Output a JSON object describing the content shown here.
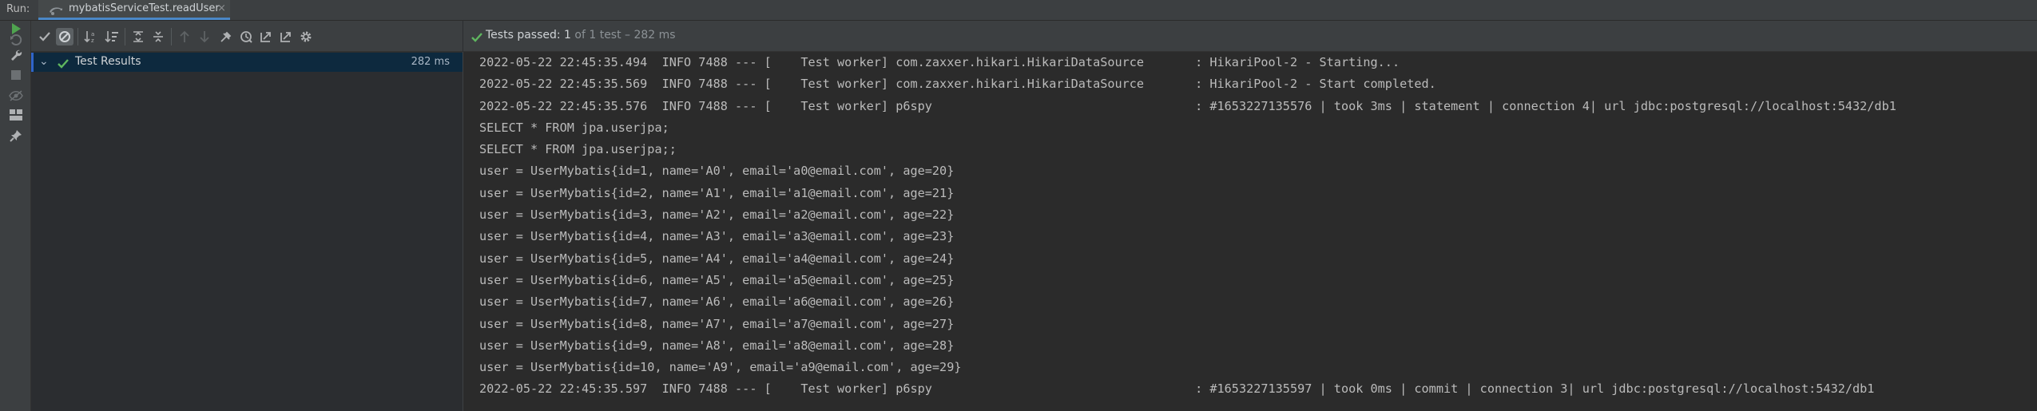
{
  "run_label": "Run:",
  "tab": {
    "title": "mybatisServiceTest.readUser",
    "close": "×",
    "icon": "test-config-icon"
  },
  "left_strip": {
    "icons": [
      "rerun-icon",
      "rerun-failed-icon",
      "wrench-icon",
      "stop-icon",
      "eye-icon",
      "layout-icon",
      "pin-icon"
    ]
  },
  "toolbar": {
    "icons": [
      "show-passed-icon",
      "show-ignored-icon",
      "sort-alpha-icon",
      "sort-duration-icon",
      "expand-all-icon",
      "collapse-all-icon",
      "previous-failed-icon",
      "next-failed-icon",
      "import-tests-icon",
      "history-icon",
      "export-icon",
      "open-external-icon",
      "settings-gear-icon"
    ],
    "pressed": "show-ignored-icon"
  },
  "status": {
    "text": "Tests passed: 1",
    "detail": " of 1 test – 282 ms",
    "color": "#5fb65f"
  },
  "tree": {
    "root": {
      "label": "Test Results",
      "time": "282 ms",
      "expanded": true,
      "status": "passed"
    }
  },
  "console": {
    "lines": [
      "2022-05-22 22:45:35.494  INFO 7488 --- [    Test worker] com.zaxxer.hikari.HikariDataSource       : HikariPool-2 - Starting...",
      "2022-05-22 22:45:35.569  INFO 7488 --- [    Test worker] com.zaxxer.hikari.HikariDataSource       : HikariPool-2 - Start completed.",
      "2022-05-22 22:45:35.576  INFO 7488 --- [    Test worker] p6spy                                    : #1653227135576 | took 3ms | statement | connection 4| url jdbc:postgresql://localhost:5432/db1",
      "SELECT * FROM jpa.userjpa;",
      "SELECT * FROM jpa.userjpa;;",
      "user = UserMybatis{id=1, name='A0', email='a0@email.com', age=20}",
      "user = UserMybatis{id=2, name='A1', email='a1@email.com', age=21}",
      "user = UserMybatis{id=3, name='A2', email='a2@email.com', age=22}",
      "user = UserMybatis{id=4, name='A3', email='a3@email.com', age=23}",
      "user = UserMybatis{id=5, name='A4', email='a4@email.com', age=24}",
      "user = UserMybatis{id=6, name='A5', email='a5@email.com', age=25}",
      "user = UserMybatis{id=7, name='A6', email='a6@email.com', age=26}",
      "user = UserMybatis{id=8, name='A7', email='a7@email.com', age=27}",
      "user = UserMybatis{id=9, name='A8', email='a8@email.com', age=28}",
      "user = UserMybatis{id=10, name='A9', email='a9@email.com', age=29}",
      "2022-05-22 22:45:35.597  INFO 7488 --- [    Test worker] p6spy                                    : #1653227135597 | took 0ms | commit | connection 3| url jdbc:postgresql://localhost:5432/db1"
    ]
  },
  "colors": {
    "background": "#2b2b2b",
    "panel": "#3c3f41",
    "selection": "#0d293e",
    "pass_green": "#5fb65f",
    "run_green": "#4fa34f",
    "accent_blue": "#4a88c7"
  }
}
